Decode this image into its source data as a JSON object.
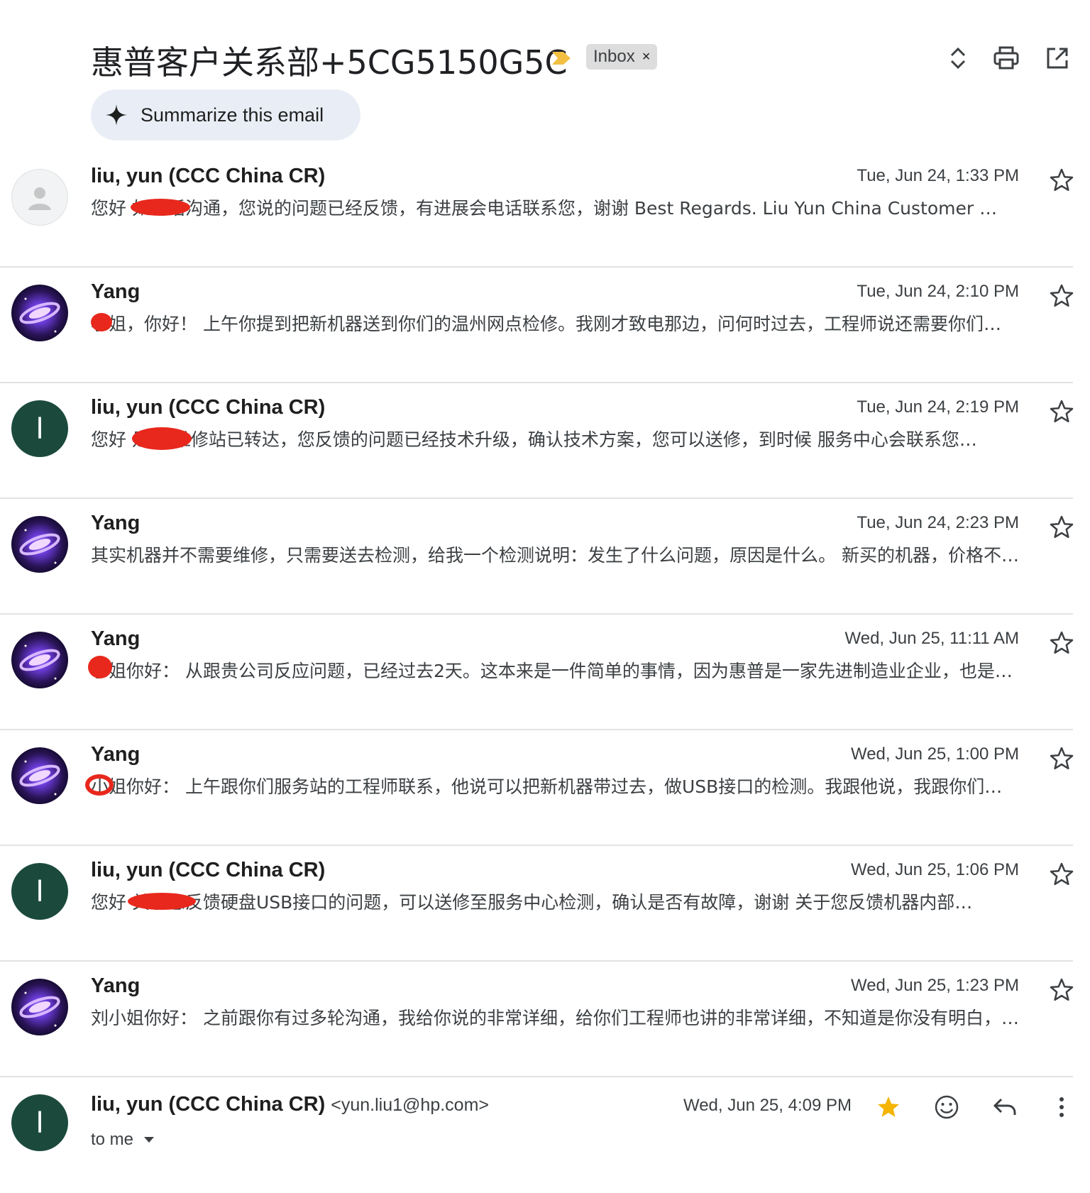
{
  "header": {
    "subject": "惠普客户关系部+5CG5150G5C",
    "label": "Inbox",
    "label_remove": "×",
    "summarize_label": "Summarize this email"
  },
  "messages": [
    {
      "sender": "liu, yun (CCC China CR)",
      "date": "Tue, Jun 24, 1:33 PM",
      "snippet": "您好        如电话沟通，您说的问题已经反馈，有进展会电话联系您，谢谢 Best Regards. Liu Yun China Customer …"
    },
    {
      "sender": "Yang",
      "date": "Tue, Jun 24, 2:10 PM",
      "snippet": " 小姐，你好！ 上午你提到把新机器送到你们的温州网点检修。我刚才致电那边，问何时过去，工程师说还需要你们…"
    },
    {
      "sender": "liu, yun (CCC China CR)",
      "date": "Tue, Jun 24, 2:19 PM",
      "snippet": "您好        是的 维修站已转达，您反馈的问题已经技术升级，确认技术方案，您可以送修，到时候 服务中心会联系您…"
    },
    {
      "sender": "Yang",
      "date": "Tue, Jun 24, 2:23 PM",
      "snippet": "其实机器并不需要维修，只需要送去检测，给我一个检测说明：发生了什么问题，原因是什么。 新买的机器，价格不…"
    },
    {
      "sender": "Yang",
      "date": "Wed, Jun 25, 11:11 AM",
      "snippet": " 小姐你好： 从跟贵公司反应问题，已经过去2天。这本来是一件简单的事情，因为惠普是一家先进制造业企业，也是…"
    },
    {
      "sender": "Yang",
      "date": "Wed, Jun 25, 1:00 PM",
      "snippet": " 小姐你好： 上午跟你们服务站的工程师联系，他说可以把新机器带过去，做USB接口的检测。我跟他说，我跟你们…"
    },
    {
      "sender": "liu, yun (CCC China CR)",
      "date": "Wed, Jun 25, 1:06 PM",
      "snippet": "您好        关于您反馈硬盘USB接口的问题，可以送修至服务中心检测，确认是否有故障，谢谢 关于您反馈机器内部…"
    },
    {
      "sender": "Yang",
      "date": "Wed, Jun 25, 1:23 PM",
      "snippet": "刘小姐你好： 之前跟你有过多轮沟通，我给你说的非常详细，给你们工程师也讲的非常详细，不知道是你没有明白，…"
    }
  ],
  "expanded": {
    "sender": "liu, yun (CCC China CR)",
    "email": "<yun.liu1@hp.com>",
    "date": "Wed, Jun 25, 4:09 PM",
    "to": "to me"
  },
  "avatar_letter": "l",
  "colors": {
    "avatar_dark_green": "#1b4a3d",
    "importance_yellow": "#f2bf42",
    "star_filled": "#f4b400",
    "redaction_red": "#e8281d"
  },
  "icons": [
    "unfold-icon",
    "print-icon",
    "open-in-new-window-icon",
    "sparkle-icon",
    "star-icon",
    "emoji-icon",
    "reply-icon",
    "more-vert-icon",
    "chevron-down-icon"
  ]
}
